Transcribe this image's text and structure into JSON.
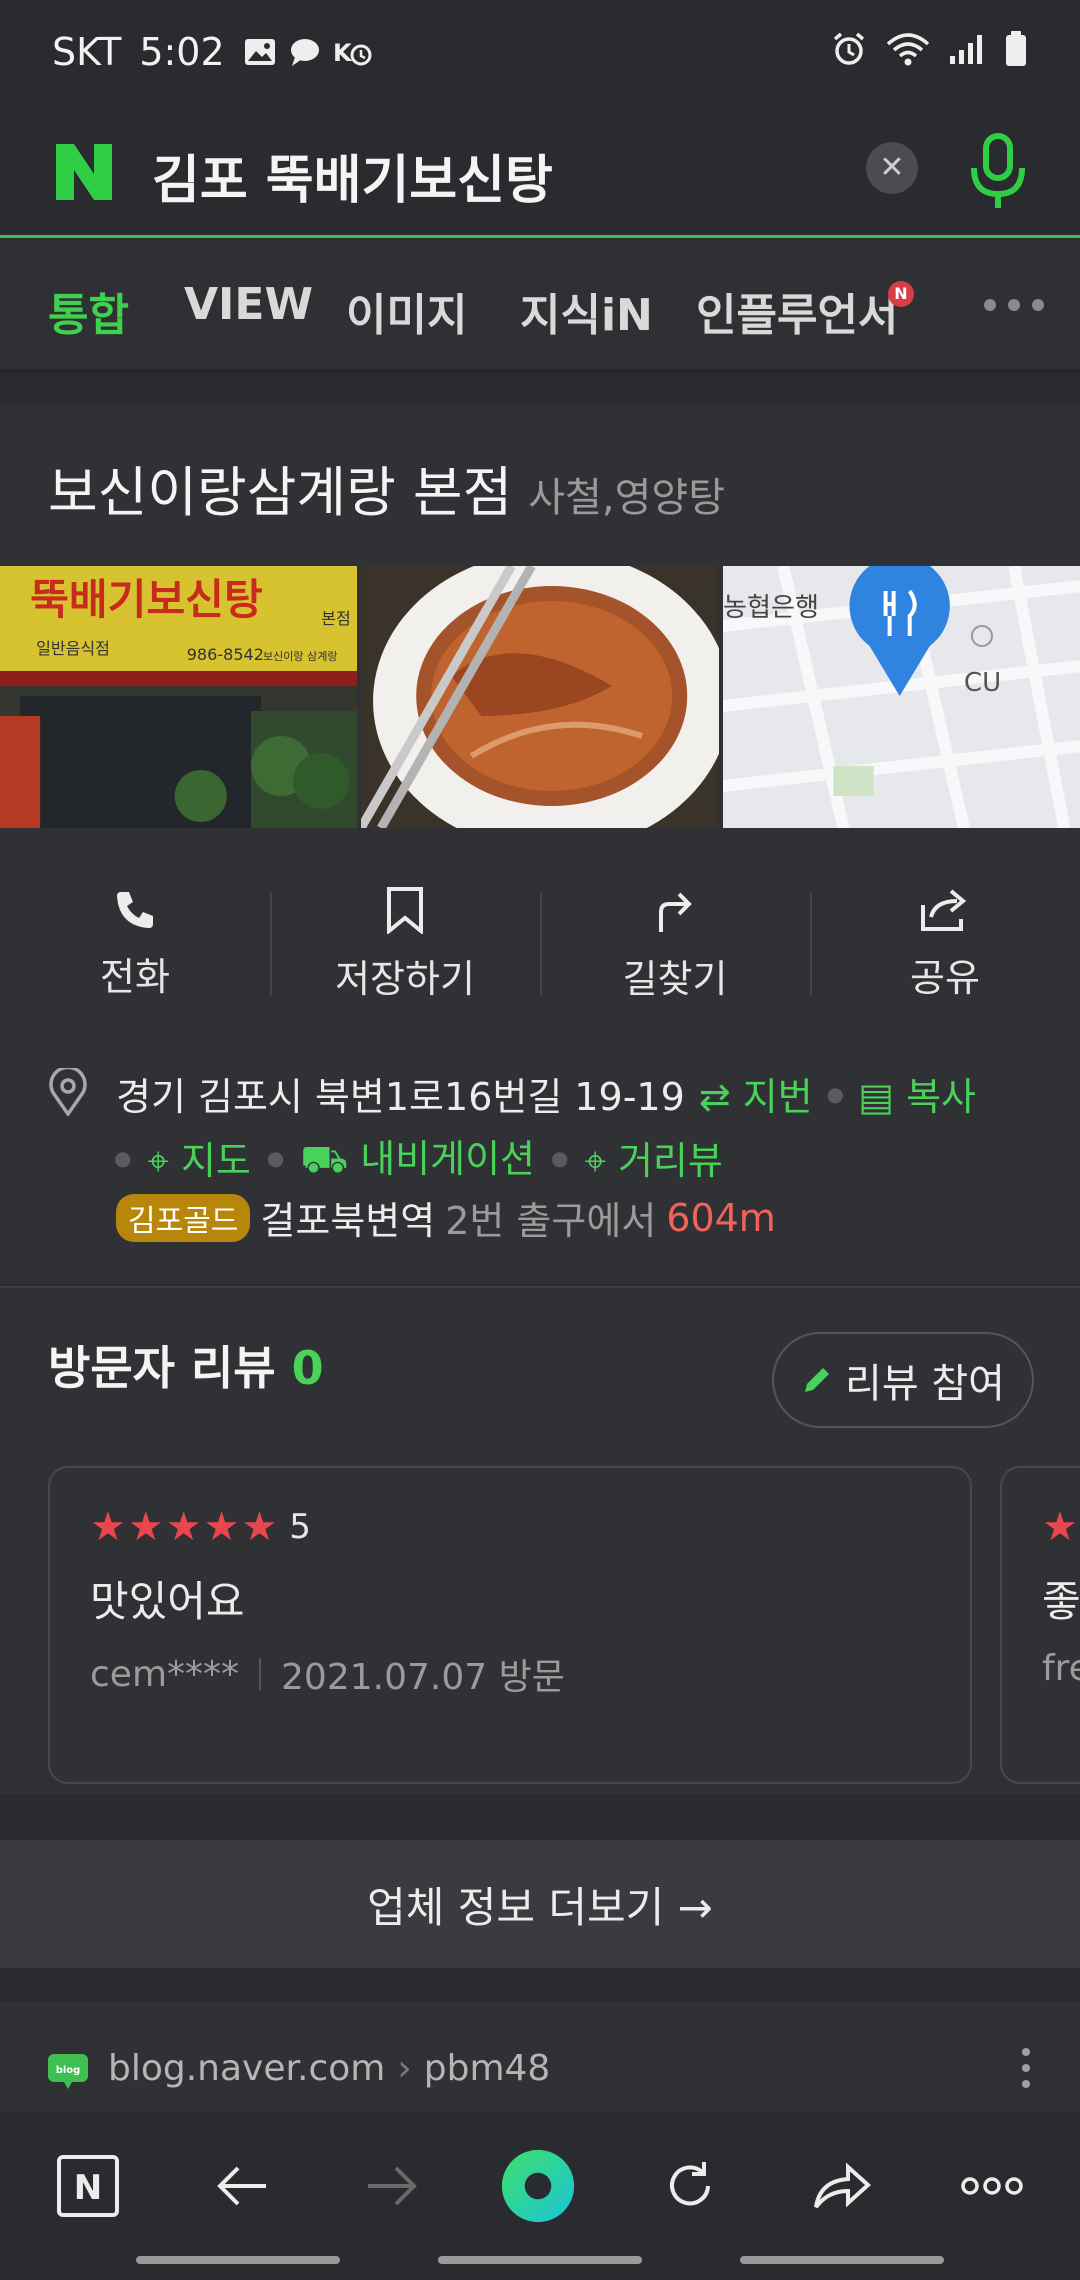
{
  "status_bar": {
    "carrier": "SKT",
    "time": "5:02"
  },
  "search": {
    "query": "김포 뚝배기보신탕",
    "logo_text": "N"
  },
  "tabs": [
    {
      "label": "통합",
      "active": true
    },
    {
      "label": "VIEW"
    },
    {
      "label": "이미지"
    },
    {
      "label": "지식iN"
    },
    {
      "label": "인플루언서",
      "badge": "N"
    }
  ],
  "place": {
    "name": "보신이랑삼계랑 본점",
    "category": "사철,영양탕",
    "photos": {
      "sign_main": "뚝배기보신탕",
      "sign_sub": "일반음식점",
      "sign_phone": "986-8542",
      "sign_side": "보신이랑 삼계랑",
      "sign_store": "본점",
      "map_bank": "농협은행",
      "map_store": "CU"
    },
    "actions": [
      {
        "label": "전화",
        "icon": "phone-icon"
      },
      {
        "label": "저장하기",
        "icon": "bookmark-icon"
      },
      {
        "label": "길찾기",
        "icon": "directions-icon"
      },
      {
        "label": "공유",
        "icon": "share-icon"
      }
    ],
    "address": "경기 김포시 북변1로16번길 19-19",
    "address_links": {
      "lot": "지번",
      "copy": "복사",
      "map": "지도",
      "navigation": "내비게이션",
      "street_view": "거리뷰"
    },
    "transit": {
      "line": "김포골드",
      "station": "걸포북변역",
      "exit_text": "2번 출구에서",
      "distance": "604m"
    }
  },
  "reviews": {
    "title": "방문자 리뷰",
    "count": "0",
    "write_label": "리뷰 참여",
    "items": [
      {
        "stars": "★★★★★",
        "rating": "5",
        "text": "맛있어요",
        "user": "cem****",
        "date": "2021.07.07 방문"
      },
      {
        "stars": "★",
        "text": "좋",
        "user": "fre"
      }
    ]
  },
  "more_info": "업체 정보 더보기 →",
  "blog": {
    "source": "blog.naver.com",
    "sep": "›",
    "author": "pbm48",
    "icon_text": "blog"
  },
  "colors": {
    "accent": "#49d15a",
    "star": "#e8474d",
    "distance": "#f0625a",
    "transit_badge": "#b8860b",
    "background": "#2a2b2e"
  }
}
